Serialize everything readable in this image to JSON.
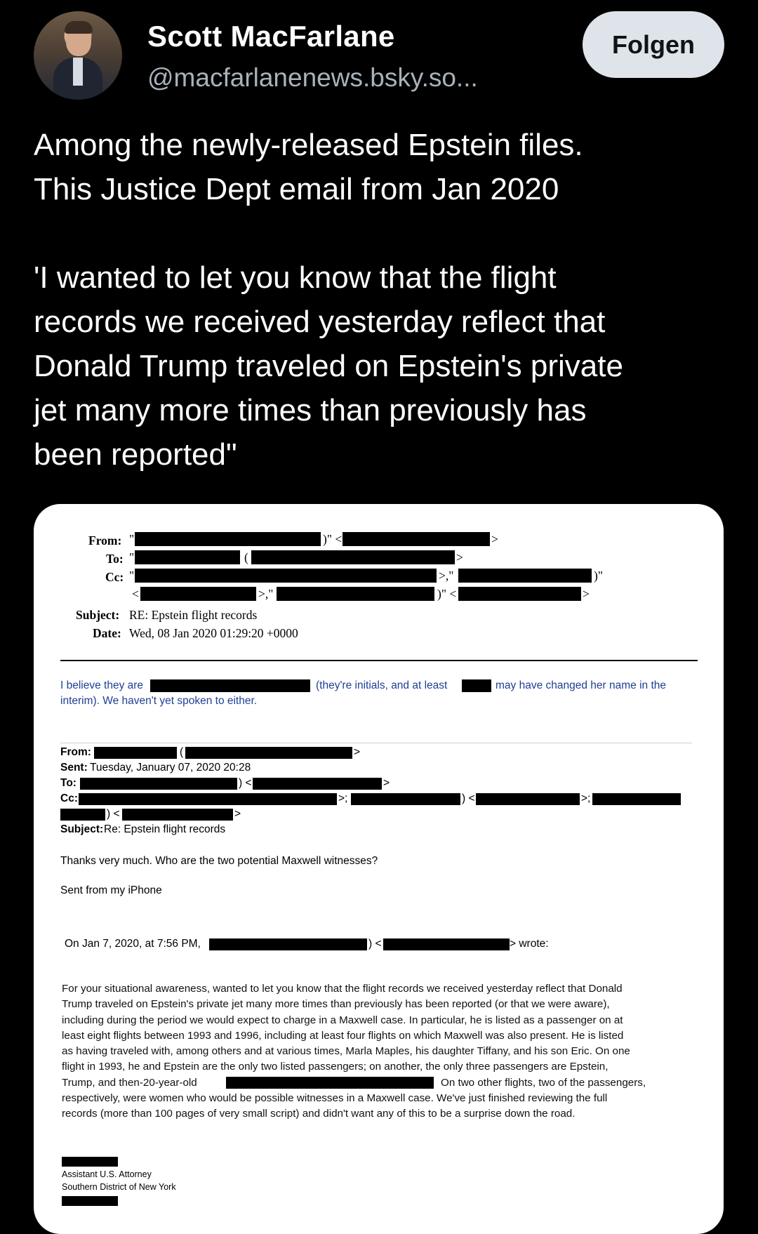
{
  "header": {
    "display_name": "Scott MacFarlane",
    "handle": "@macfarlanenews.bsky.so...",
    "follow_label": "Folgen"
  },
  "post": {
    "paragraph1_line1": "Among the newly-released Epstein files.",
    "paragraph1_line2": "This Justice Dept email from Jan 2020",
    "paragraph2": [
      "'I wanted to let you know that the flight",
      "records we received yesterday reflect that",
      "Donald Trump traveled on Epstein's private",
      "jet many more times than previously has",
      "been reported\""
    ]
  },
  "document": {
    "top_email": {
      "from_label": "From:",
      "to_label": "To:",
      "cc_label": "Cc:",
      "subject_label": "Subject:",
      "subject_value": "RE: Epstein flight records",
      "date_label": "Date:",
      "date_value": "Wed, 08 Jan 2020 01:29:20 +0000"
    },
    "reply_line1_a": "I believe they are",
    "reply_line1_b": "(they're initials, and at least",
    "reply_line1_c": "may have changed her name in the",
    "reply_line2": "interim).  We haven't yet spoken to either.",
    "second_email": {
      "from_label": "From:",
      "sent_label": "Sent:",
      "sent_value": "Tuesday, January 07, 2020 20:28",
      "to_label": "To:",
      "cc_label": "Cc:",
      "subject_label": "Subject:",
      "subject_value": "Re: Epstein flight records"
    },
    "thanks_line": "Thanks very much.  Who are the two potential Maxwell witnesses?",
    "sent_from": "Sent from my iPhone",
    "on_date": "On Jan 7, 2020, at 7:56 PM,",
    "wrote": "> wrote:",
    "body_lines": [
      "For your situational awareness, wanted to let you know that the flight records we received yesterday reflect that Donald",
      "Trump traveled on Epstein's private jet many more times than previously has been reported (or that we were aware),",
      "including during the period we would expect to charge in a Maxwell case.  In particular, he is listed as a passenger on at",
      "least eight flights between 1993 and 1996, including at least four flights on which Maxwell was also present.  He is listed",
      "as having traveled with, among others and at various times, Marla Maples, his daughter Tiffany, and his son Eric.  On one",
      "flight in 1993, he and Epstein are the only two listed passengers; on another, the only three passengers are Epstein,"
    ],
    "body_line7_a": "Trump, and then-20-year-old",
    "body_line7_b": "On two other flights, two of the passengers,",
    "body_line8": "respectively, were women who would be possible witnesses in a Maxwell case.  We've just finished reviewing the full",
    "body_line9": "records (more than 100 pages of very small script) and didn't want any of this to be a surprise down the road.",
    "signature_title": "Assistant U.S. Attorney",
    "signature_office": "Southern District of New York"
  }
}
